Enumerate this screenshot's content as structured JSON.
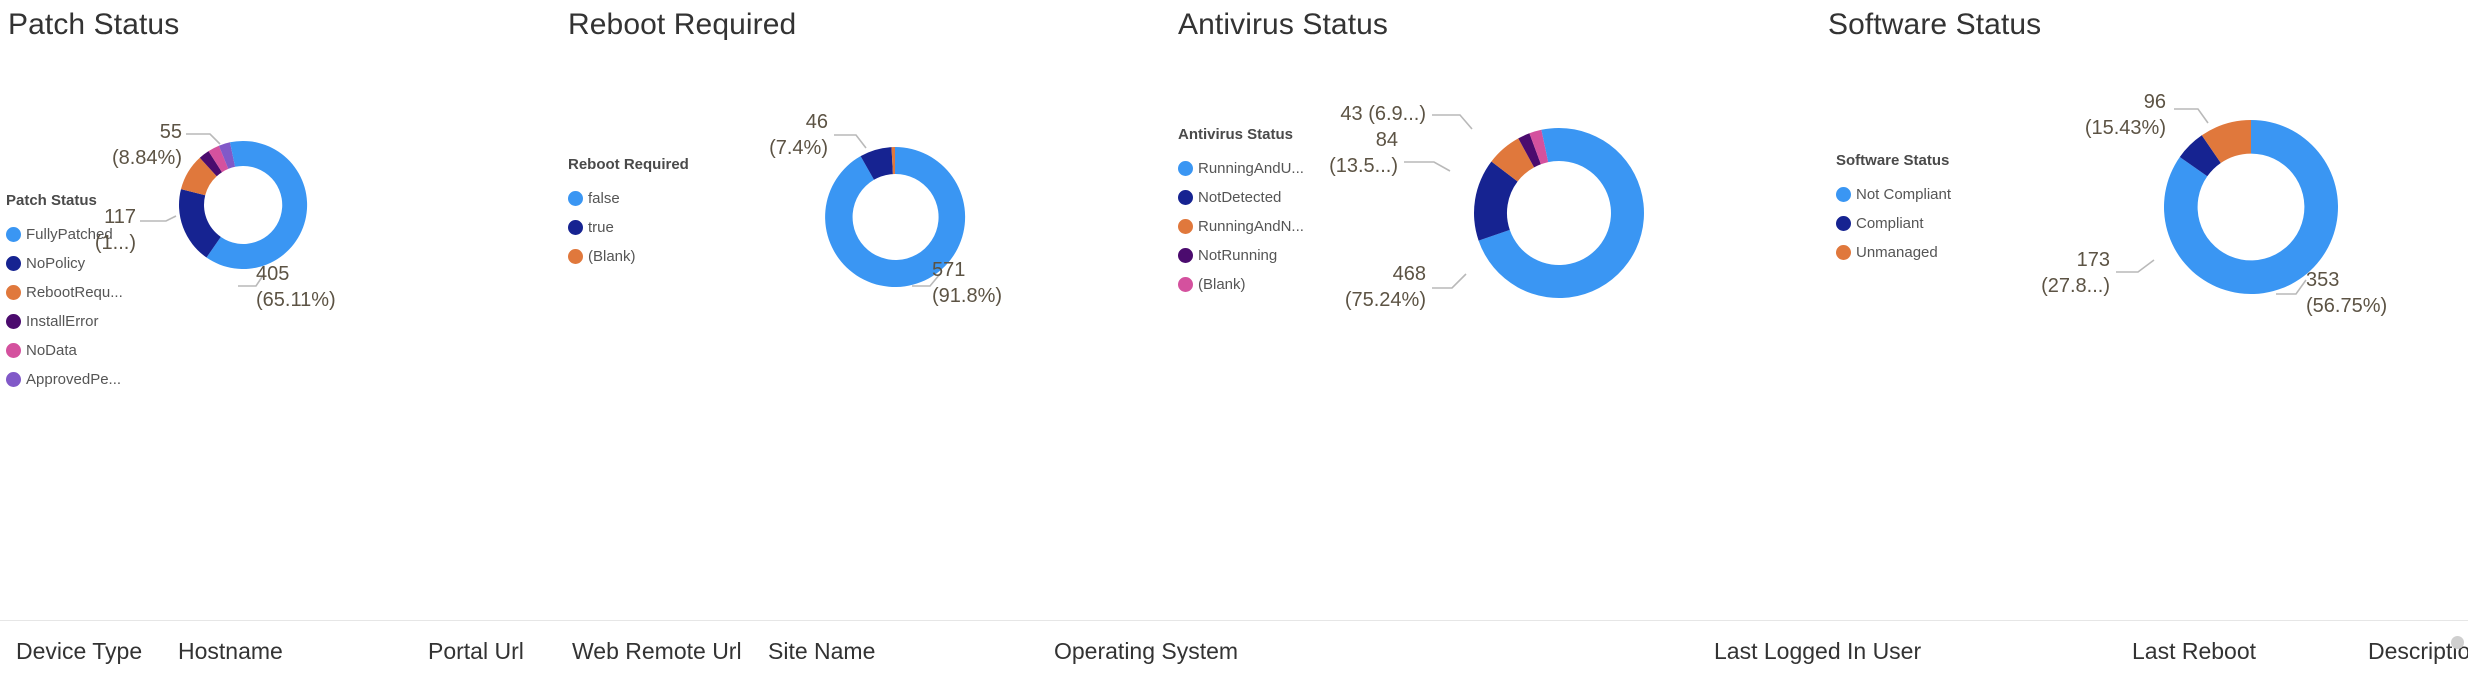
{
  "colors": {
    "lightblue": "#3a96f3",
    "navy": "#162391",
    "orange": "#e0783c",
    "purple": "#4b0b6e",
    "pink": "#d4519e",
    "violet": "#8159c8",
    "label_text": "#5c5344",
    "title_text": "#333333",
    "leader_line": "#b9b9b9"
  },
  "panels": [
    {
      "title": "Patch Status",
      "legend_title": "Patch Status",
      "legend": [
        {
          "label": "FullyPatched",
          "color": "#3a96f3"
        },
        {
          "label": "NoPolicy",
          "color": "#162391"
        },
        {
          "label": "RebootRequ...",
          "color": "#e0783c"
        },
        {
          "label": "InstallError",
          "color": "#4b0b6e"
        },
        {
          "label": "NoData",
          "color": "#d4519e"
        },
        {
          "label": "ApprovedPe...",
          "color": "#8159c8"
        }
      ],
      "labels": [
        {
          "value": "55",
          "percent": "(8.84%)"
        },
        {
          "value": "117",
          "percent": "(1...)"
        },
        {
          "value": "405",
          "percent": "(65.11%)"
        }
      ]
    },
    {
      "title": "Reboot Required",
      "legend_title": "Reboot Required",
      "legend": [
        {
          "label": "false",
          "color": "#3a96f3"
        },
        {
          "label": "true",
          "color": "#162391"
        },
        {
          "label": "(Blank)",
          "color": "#e0783c"
        }
      ],
      "labels": [
        {
          "value": "46",
          "percent": "(7.4%)"
        },
        {
          "value": "571",
          "percent": "(91.8%)"
        }
      ]
    },
    {
      "title": "Antivirus Status",
      "legend_title": "Antivirus Status",
      "legend": [
        {
          "label": "RunningAndU...",
          "color": "#3a96f3"
        },
        {
          "label": "NotDetected",
          "color": "#162391"
        },
        {
          "label": "RunningAndN...",
          "color": "#e0783c"
        },
        {
          "label": "NotRunning",
          "color": "#4b0b6e"
        },
        {
          "label": "(Blank)",
          "color": "#d4519e"
        }
      ],
      "labels": [
        {
          "value": "43 (6.9...)",
          "percent": ""
        },
        {
          "value": "84",
          "percent": "(13.5...)"
        },
        {
          "value": "468",
          "percent": "(75.24%)"
        }
      ]
    },
    {
      "title": "Software Status",
      "legend_title": "Software Status",
      "legend": [
        {
          "label": "Not Compliant",
          "color": "#3a96f3"
        },
        {
          "label": "Compliant",
          "color": "#162391"
        },
        {
          "label": "Unmanaged",
          "color": "#e0783c"
        }
      ],
      "labels": [
        {
          "value": "96",
          "percent": "(15.43%)"
        },
        {
          "value": "173",
          "percent": "(27.8...)"
        },
        {
          "value": "353",
          "percent": "(56.75%)"
        }
      ]
    }
  ],
  "table": {
    "columns": [
      "Device Type",
      "Hostname",
      "Portal Url",
      "Web Remote Url",
      "Site Name",
      "Operating System",
      "Last Logged In User",
      "Last Reboot",
      "Descriptio"
    ]
  },
  "chart_data": [
    {
      "type": "pie",
      "title": "Patch Status",
      "legend_position": "left",
      "categories": [
        "FullyPatched",
        "NoPolicy",
        "RebootRequ...",
        "InstallError",
        "NoData",
        "ApprovedPe..."
      ],
      "values": [
        405,
        117,
        55,
        14,
        17,
        14
      ],
      "percents": [
        65.11,
        18.81,
        8.84,
        2.25,
        2.73,
        2.25
      ],
      "labels_shown": [
        "405 (65.11%)",
        "117 (1...)",
        "55 (8.84%)"
      ],
      "colors": [
        "#3a96f3",
        "#162391",
        "#e0783c",
        "#4b0b6e",
        "#d4519e",
        "#8159c8"
      ]
    },
    {
      "type": "pie",
      "title": "Reboot Required",
      "legend_position": "left",
      "categories": [
        "false",
        "true",
        "(Blank)"
      ],
      "values": [
        571,
        46,
        5
      ],
      "percents": [
        91.8,
        7.4,
        0.8
      ],
      "labels_shown": [
        "571 (91.8%)",
        "46 (7.4%)"
      ],
      "colors": [
        "#3a96f3",
        "#162391",
        "#e0783c"
      ]
    },
    {
      "type": "pie",
      "title": "Antivirus Status",
      "legend_position": "left",
      "categories": [
        "RunningAndU...",
        "NotDetected",
        "RunningAndN...",
        "NotRunning",
        "(Blank)"
      ],
      "values": [
        468,
        84,
        43,
        13,
        14
      ],
      "percents": [
        75.24,
        13.5,
        6.9,
        2.09,
        2.25
      ],
      "labels_shown": [
        "468 (75.24%)",
        "84 (13.5...)",
        "43 (6.9...)"
      ],
      "colors": [
        "#3a96f3",
        "#162391",
        "#e0783c",
        "#4b0b6e",
        "#d4519e"
      ]
    },
    {
      "type": "pie",
      "title": "Software Status",
      "legend_position": "left",
      "categories": [
        "Not Compliant",
        "Compliant",
        "Unmanaged"
      ],
      "values": [
        353,
        173,
        96
      ],
      "percents": [
        56.75,
        27.8,
        15.43
      ],
      "labels_shown": [
        "353 (56.75%)",
        "173 (27.8...)",
        "96 (15.43%)"
      ],
      "colors": [
        "#3a96f3",
        "#162391",
        "#e0783c"
      ]
    }
  ]
}
